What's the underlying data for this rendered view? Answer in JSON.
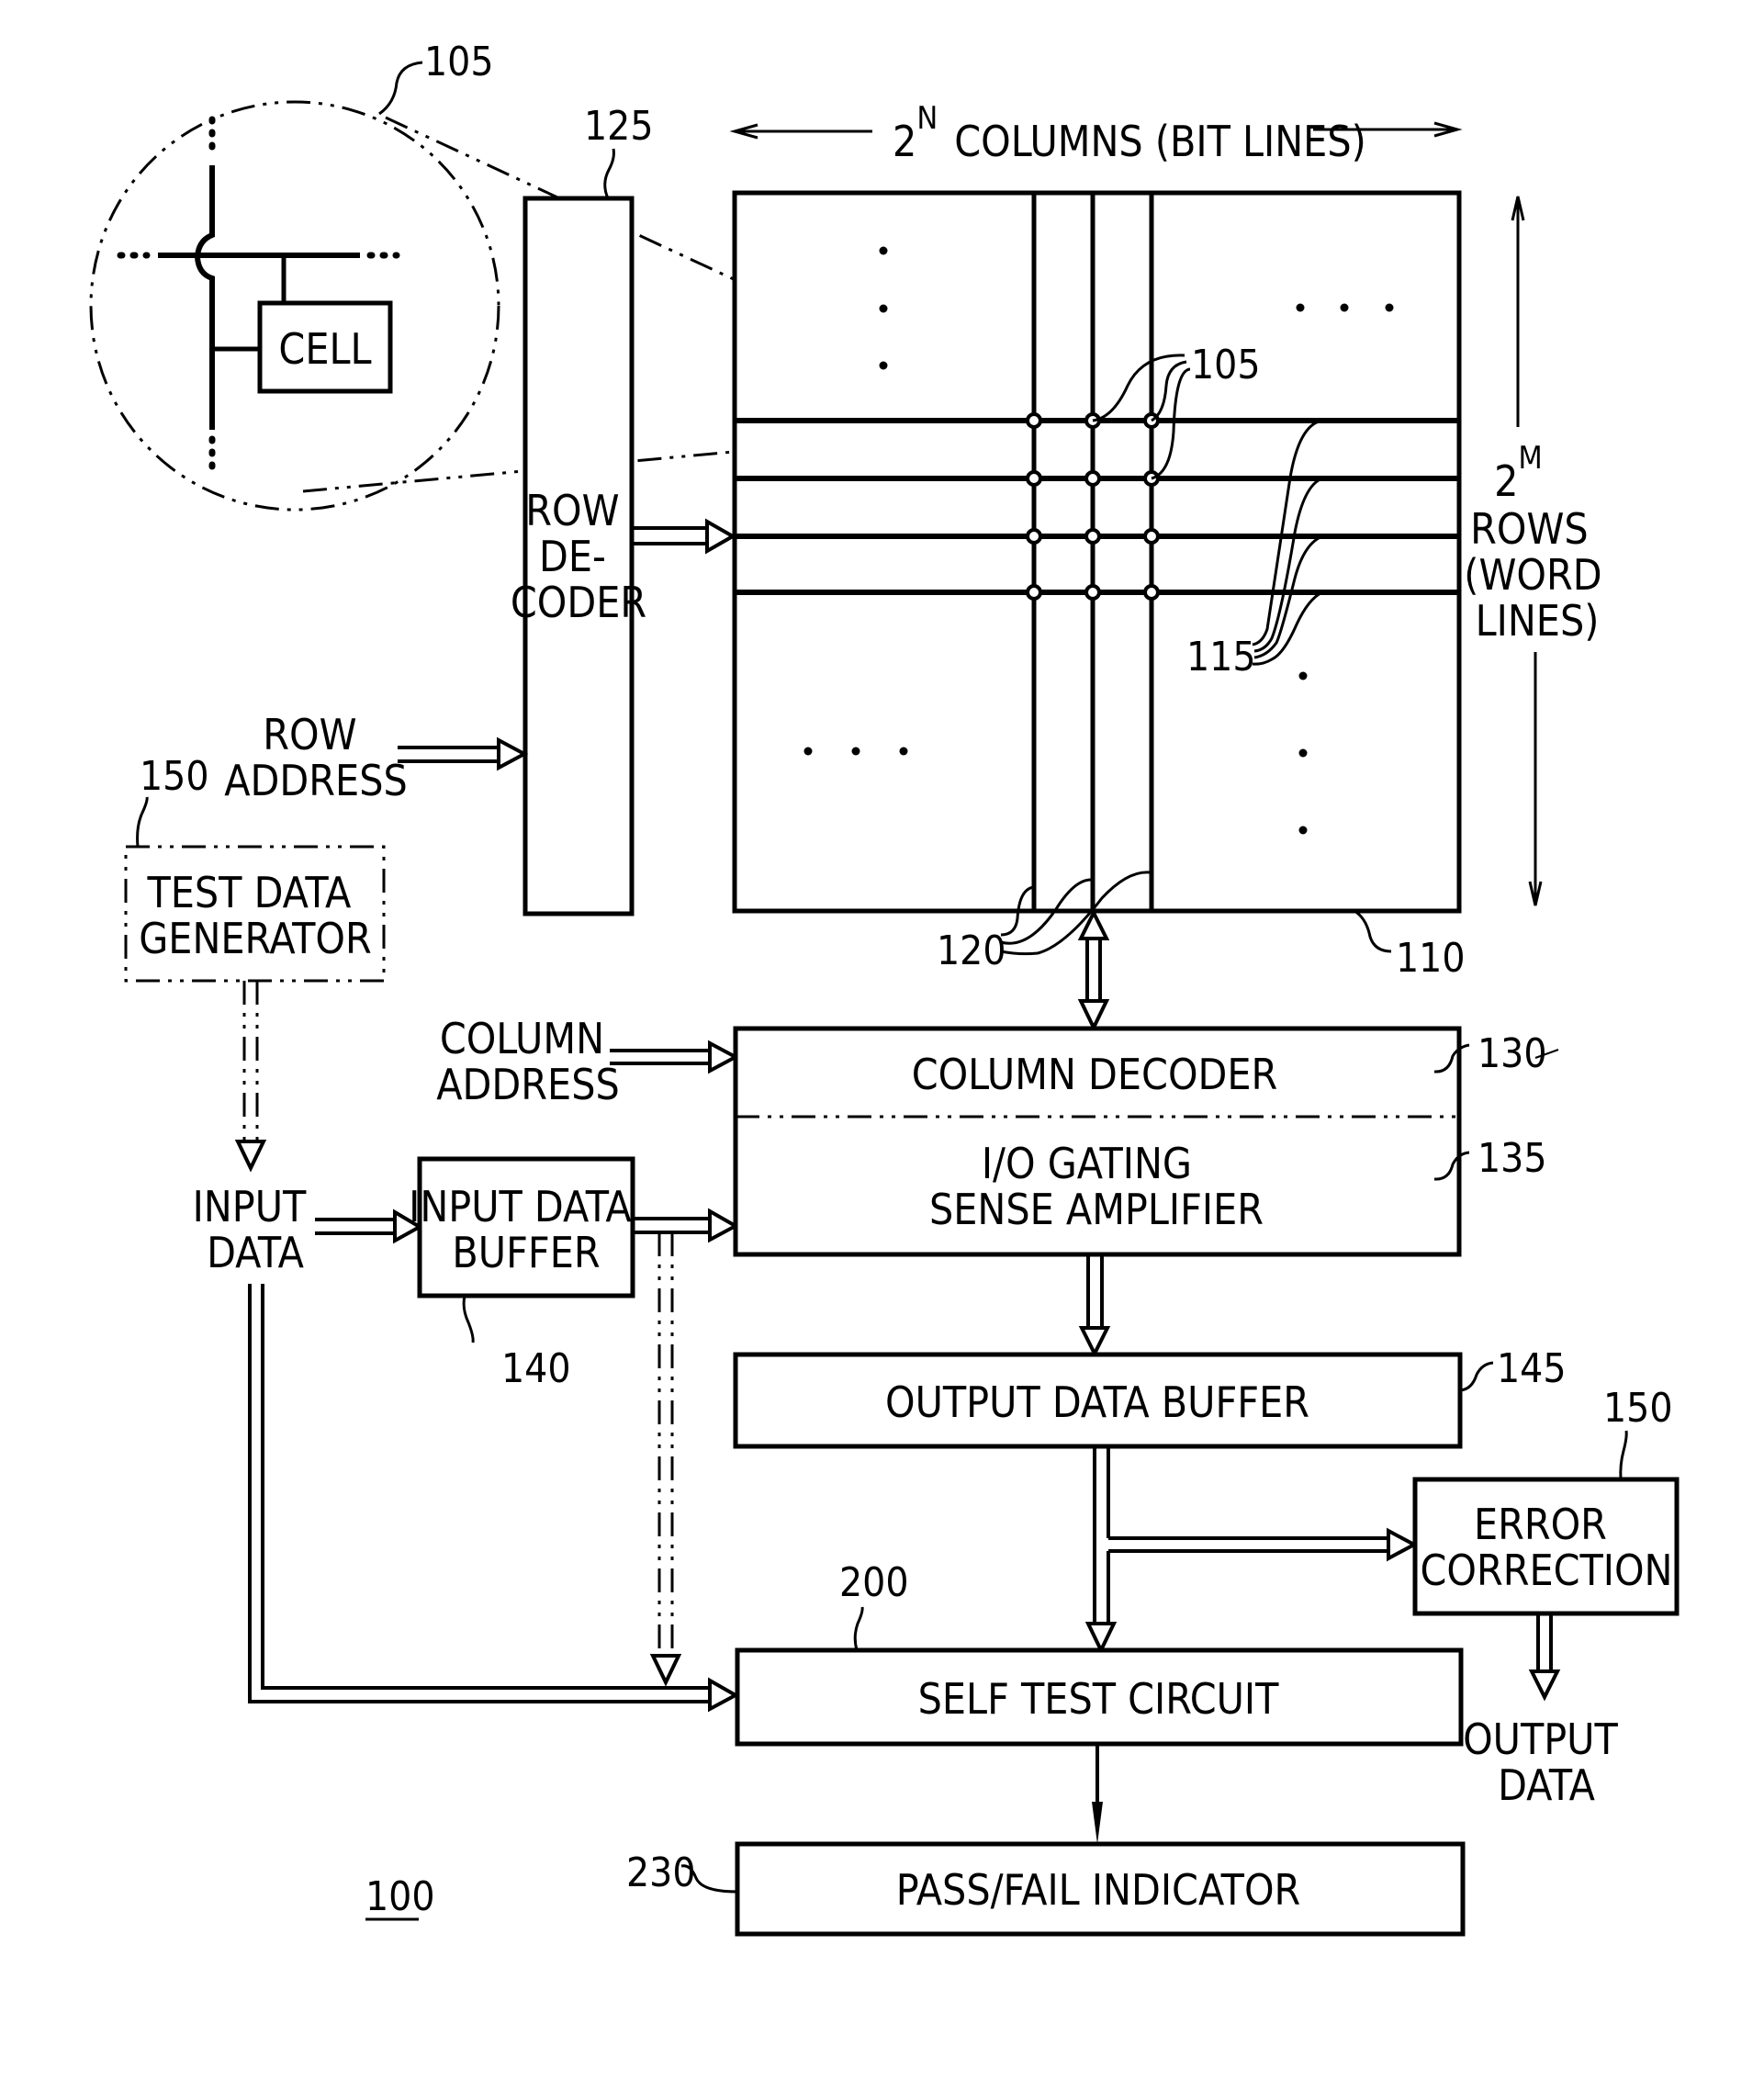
{
  "figure_number": "100",
  "memory_array": {
    "ref": "110",
    "columns_label": "COLUMNS (BIT LINES)",
    "columns_base": "2",
    "columns_exp": "N",
    "rows_base": "2",
    "rows_exp": "M",
    "rows_label_lines": [
      "ROWS",
      "(WORD",
      "LINES)"
    ],
    "cell_ref": "105",
    "word_line_ref": "115",
    "bit_line_ref": "120"
  },
  "zoom_inset": {
    "ref": "105",
    "cell_label": "CELL"
  },
  "row_decoder": {
    "ref": "125",
    "label_lines": [
      "ROW",
      "DE-",
      "CODER"
    ]
  },
  "row_address": {
    "label_lines": [
      "ROW",
      "ADDRESS"
    ]
  },
  "test_data_generator": {
    "ref": "150",
    "label_lines": [
      "TEST DATA",
      "GENERATOR"
    ]
  },
  "column_address": {
    "label_lines": [
      "COLUMN",
      "ADDRESS"
    ]
  },
  "column_decoder": {
    "ref": "130",
    "label": "COLUMN DECODER"
  },
  "io_gating": {
    "ref": "135",
    "label_lines": [
      "I/O GATING",
      "SENSE AMPLIFIER"
    ]
  },
  "input_data": {
    "label_lines": [
      "INPUT",
      "DATA"
    ]
  },
  "input_data_buffer": {
    "ref": "140",
    "label_lines": [
      "INPUT DATA",
      "BUFFER"
    ]
  },
  "output_data_buffer": {
    "ref": "145",
    "label": "OUTPUT DATA BUFFER"
  },
  "error_correction": {
    "ref": "150",
    "label_lines": [
      "ERROR",
      "CORRECTION"
    ]
  },
  "output_data": {
    "label_lines": [
      "OUTPUT",
      "DATA"
    ]
  },
  "self_test_circuit": {
    "ref": "200",
    "label": "SELF TEST CIRCUIT"
  },
  "pass_fail_indicator": {
    "ref": "230",
    "label": "PASS/FAIL INDICATOR"
  }
}
